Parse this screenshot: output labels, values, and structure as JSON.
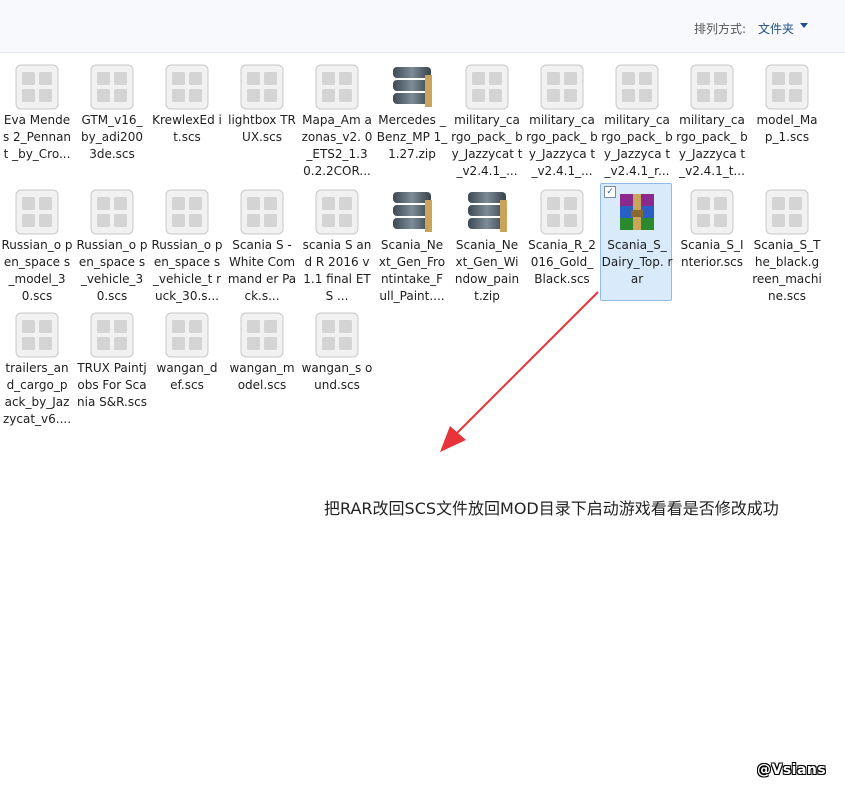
{
  "toolbar": {
    "sort_label": "排列方式:",
    "sort_value": "文件夹"
  },
  "files": [
    {
      "name": "Eva Mendes 2_Pennant _by_Cro...",
      "icon": "generic-file-icon"
    },
    {
      "name": "GTM_v16_ by_adi200 3de.scs",
      "icon": "generic-file-icon"
    },
    {
      "name": "KrewlexEd it.scs",
      "icon": "generic-file-icon"
    },
    {
      "name": "lightbox TRUX.scs",
      "icon": "generic-file-icon"
    },
    {
      "name": "Mapa_Am azonas_v2. 0_ETS2_1.3 0.2.2COR...",
      "icon": "generic-file-icon"
    },
    {
      "name": "Mercedes _Benz_MP 1_1.27.zip",
      "icon": "archive-stack-icon"
    },
    {
      "name": "military_ca rgo_pack_ by_Jazzycat t_v2.4.1_...",
      "icon": "generic-file-icon"
    },
    {
      "name": "military_ca rgo_pack_ by_Jazzyca t_v2.4.1_...",
      "icon": "generic-file-icon"
    },
    {
      "name": "military_ca rgo_pack_ by_Jazzyca t_v2.4.1_r...",
      "icon": "generic-file-icon"
    },
    {
      "name": "military_ca rgo_pack_ by_Jazzyca t_v2.4.1_t...",
      "icon": "generic-file-icon"
    },
    {
      "name": "model_Ma p_1.scs",
      "icon": "generic-file-icon"
    },
    {
      "name": "Russian_o pen_space s_model_3 0.scs",
      "icon": "generic-file-icon"
    },
    {
      "name": "Russian_o pen_space s_vehicle_3 0.scs",
      "icon": "generic-file-icon"
    },
    {
      "name": "Russian_o pen_space s_vehicle_t ruck_30.s...",
      "icon": "generic-file-icon"
    },
    {
      "name": "Scania S - White Command er Pack.s...",
      "icon": "generic-file-icon"
    },
    {
      "name": "scania S and R 2016 v1.1 final ETS ...",
      "icon": "generic-file-icon"
    },
    {
      "name": "Scania_Ne xt_Gen_Fro ntintake_F ull_Paint....",
      "icon": "archive-stack-icon"
    },
    {
      "name": "Scania_Ne xt_Gen_Wi ndow_pain t.zip",
      "icon": "archive-stack-icon"
    },
    {
      "name": "Scania_R_2 016_Gold_ Black.scs",
      "icon": "generic-file-icon"
    },
    {
      "name": "Scania_S_ Dairy_Top. rar",
      "icon": "winrar-archive-icon",
      "selected": true
    },
    {
      "name": "Scania_S_I nterior.scs",
      "icon": "generic-file-icon"
    },
    {
      "name": "Scania_S_T he_black.g reen_machi ne.scs",
      "icon": "generic-file-icon"
    },
    {
      "name": "trailers_an d_cargo_p ack_by_Jaz zycat_v6....",
      "icon": "generic-file-icon"
    },
    {
      "name": "TRUX Paintjobs For Scania S&R.scs",
      "icon": "generic-file-icon"
    },
    {
      "name": "wangan_d ef.scs",
      "icon": "generic-file-icon"
    },
    {
      "name": "wangan_m odel.scs",
      "icon": "generic-file-icon"
    },
    {
      "name": "wangan_s ound.scs",
      "icon": "generic-file-icon"
    }
  ],
  "annotation": "把RAR改回SCS文件放回MOD目录下启动游戏看看是否修改成功",
  "watermark": "@Vsians",
  "colors": {
    "arrow": "#e8333a",
    "selection": "#d9ebfb",
    "link": "#1e4e8c"
  }
}
